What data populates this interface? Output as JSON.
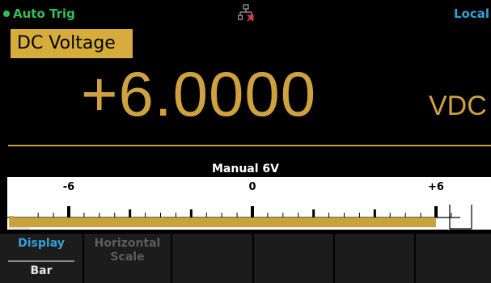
{
  "status": {
    "trigger": "Auto Trig",
    "mode": "Local",
    "trigger_color": "#2fbf5a",
    "mode_color": "#2fa3d8",
    "network_icon": "lan-network-icon"
  },
  "measurement": {
    "function": "DC Voltage",
    "value": "+6.0000",
    "unit": "VDC",
    "accent_color": "#cfa23f"
  },
  "bar": {
    "range_label": "Manual 6V",
    "min_label": "-6",
    "mid_label": "0",
    "max_label": "+6",
    "min": -6,
    "max": 6,
    "value": 6.0,
    "fill_color": "#c9a23e"
  },
  "softkeys": [
    {
      "top": "Display",
      "bottom": "Bar",
      "enabled": true
    },
    {
      "top": "Horizontal",
      "bottom": "Scale",
      "enabled": false
    },
    {
      "top": "",
      "bottom": "",
      "enabled": false
    },
    {
      "top": "",
      "bottom": "",
      "enabled": false
    },
    {
      "top": "",
      "bottom": "",
      "enabled": false
    },
    {
      "top": "",
      "bottom": "",
      "enabled": false
    }
  ]
}
